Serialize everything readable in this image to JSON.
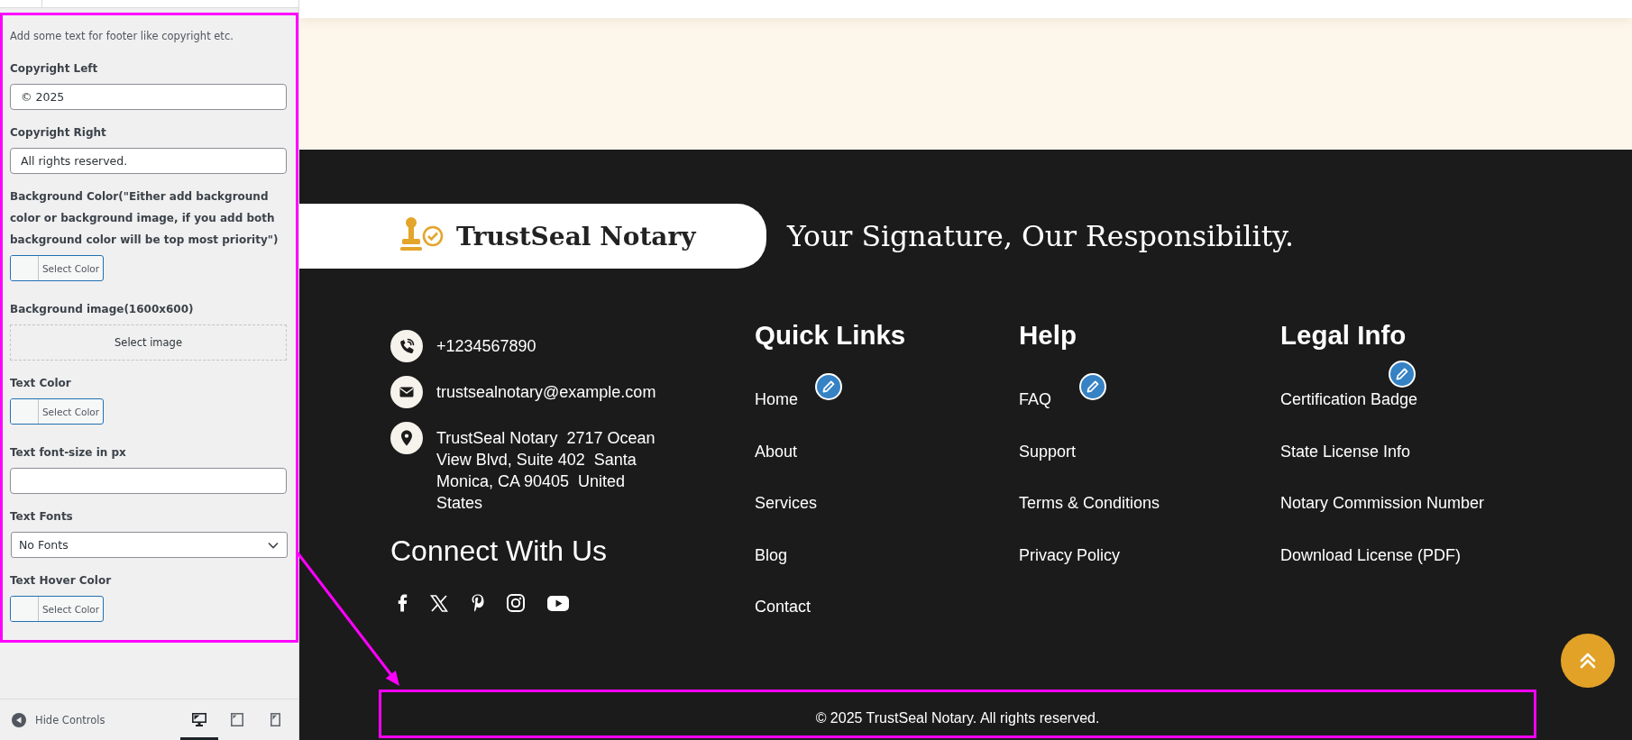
{
  "controls_panel": {
    "highlighted": true,
    "description": "Add some text for footer like copyright etc.",
    "controls": [
      {
        "kind": "text",
        "label": "Copyright Left",
        "value": "© 2025"
      },
      {
        "kind": "text",
        "label": "Copyright Right",
        "value": "All rights reserved."
      },
      {
        "kind": "color",
        "label": "Background Color(\"Either add background color or background image, if you add both background color will be top most priority\")",
        "button": "Select Color"
      },
      {
        "kind": "image",
        "label": "Background image(1600x600)",
        "button": "Select image"
      },
      {
        "kind": "color",
        "label": "Text Color",
        "button": "Select Color"
      },
      {
        "kind": "text",
        "label": "Text font-size in px"
      },
      {
        "kind": "select",
        "label": "Text Fonts",
        "value": "No Fonts"
      },
      {
        "kind": "color",
        "label": "Text Hover Color",
        "button": "Select Color"
      }
    ]
  },
  "panel_footer": {
    "hide_controls": "Hide Controls",
    "devices": [
      {
        "kind": "desktop",
        "selected": true
      },
      {
        "kind": "tablet",
        "selected": false
      },
      {
        "kind": "mobile",
        "selected": false
      }
    ]
  },
  "footer": {
    "logo": "TrustSeal Notary",
    "tagline": "Your Signature, Our Responsibility.",
    "contacts": [
      {
        "kind": "phone",
        "text": "+1234567890"
      },
      {
        "kind": "email",
        "text": "trustsealnotary@example.com"
      },
      {
        "kind": "address",
        "text": "TrustSeal Notary  2717 Ocean View Blvd, Suite 402  Santa Monica, CA 90405  United States"
      }
    ],
    "connect_heading": "Connect With Us",
    "social": [
      {
        "kind": "facebook"
      },
      {
        "kind": "x"
      },
      {
        "kind": "pinterest"
      },
      {
        "kind": "instagram"
      },
      {
        "kind": "youtube"
      }
    ],
    "columns": [
      {
        "title": "Quick Links",
        "edit_shortcut": true,
        "links": [
          "Home",
          "About",
          "Services",
          "Blog",
          "Contact"
        ]
      },
      {
        "title": "Help",
        "edit_shortcut": true,
        "links": [
          "FAQ",
          "Support",
          "Terms & Conditions",
          "Privacy Policy"
        ]
      },
      {
        "title": "Legal Info",
        "edit_shortcut": true,
        "links": [
          "Certification Badge",
          "State License Info",
          "Notary Commission Number",
          "Download License (PDF)"
        ]
      }
    ],
    "copyright": {
      "text": "© 2025 TrustSeal Notary. All rights reserved.",
      "highlighted": true,
      "callout_arrow": true
    }
  }
}
